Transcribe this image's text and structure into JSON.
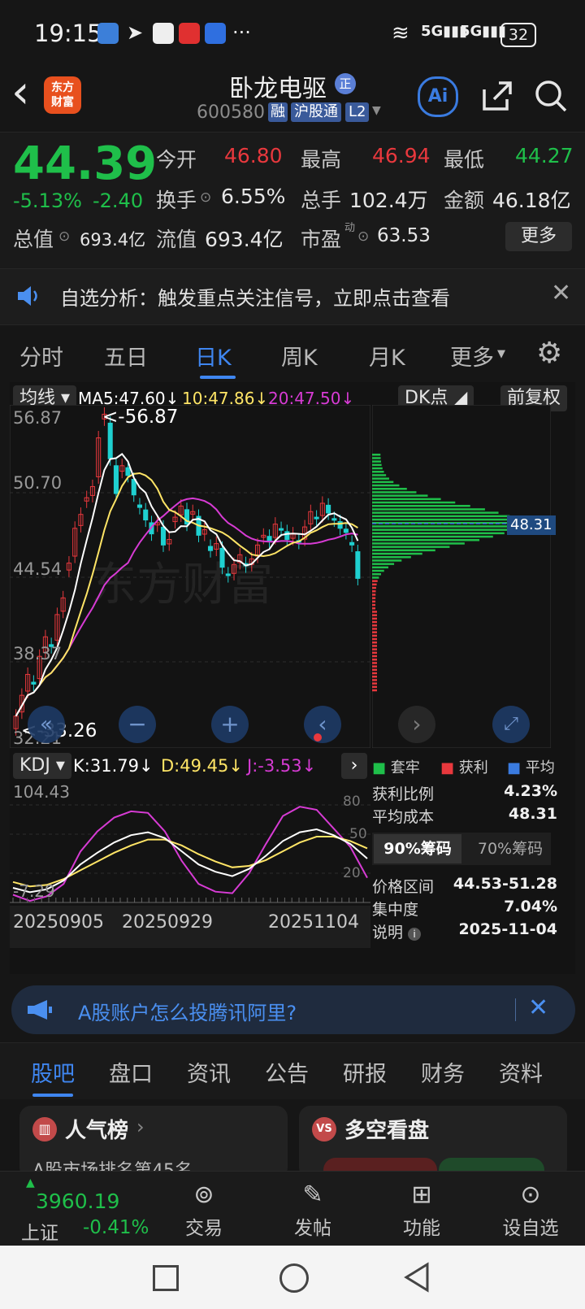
{
  "status_bar": {
    "time": "19:15",
    "battery": "32",
    "more": "···"
  },
  "header": {
    "back_glyph": "‹",
    "logo_line1": "东方",
    "logo_line2": "财富",
    "stock_name": "卧龙电驱",
    "stock_badge": "正",
    "code": "600580",
    "tag_rong": "融",
    "tag_hgt": "沪股通",
    "tag_l2": "L2",
    "ai_label": "Ai"
  },
  "quote": {
    "price": "44.39",
    "change_pct": "-5.13%",
    "change_amt": "-2.40",
    "open_label": "今开",
    "open": "46.80",
    "high_label": "最高",
    "high": "46.94",
    "low_label": "最低",
    "low": "44.27",
    "turnover_label": "换手",
    "turnover": "6.55%",
    "volume_label": "总手",
    "volume": "102.4万",
    "amount_label": "金额",
    "amount": "46.18亿",
    "mktcap_label": "总值",
    "mktcap": "693.4亿",
    "float_label": "流值",
    "float": "693.4亿",
    "pe_label": "市盈",
    "pe_sup": "动",
    "pe": "63.53",
    "more_label": "更多"
  },
  "banner": {
    "text": "自选分析：触发重点关注信号，立即点击查看"
  },
  "period_tabs": [
    "分时",
    "五日",
    "日K",
    "周K",
    "月K",
    "更多"
  ],
  "active_tab": 2,
  "chart": {
    "ma_selector": "均线",
    "ma5": "MA5:47.60↓",
    "ma10": "10:47.86↓",
    "ma20": "20:47.50↓",
    "dk_label": "DK点",
    "adjust_label": "前复权",
    "price_axis": [
      "56.87",
      "50.70",
      "44.54",
      "38.37",
      "32.21"
    ],
    "max_mark": "<-56.87",
    "min_mark": "<-33.26",
    "chip_avg": "48.31",
    "kdj_selector": "KDJ",
    "kdj_k": "K:31.79↓",
    "kdj_d": "D:49.45↓",
    "kdj_j": "J:-3.53↓",
    "kdj_axis": [
      "104.43",
      "-7.29"
    ],
    "kdj_right": [
      "80",
      "50",
      "20"
    ],
    "dates": [
      "20250905",
      "20250929",
      "20251104"
    ],
    "colors": {
      "up": "#e8383d",
      "down": "#1fd0d0",
      "ma5": "#ffffff",
      "ma10": "#ffe566",
      "ma20": "#d73bd4"
    }
  },
  "chips": {
    "legend_trapped": "套牢",
    "legend_profit": "获利",
    "legend_avg": "平均",
    "profit_ratio_label": "获利比例",
    "profit_ratio": "4.23%",
    "avg_cost_label": "平均成本",
    "avg_cost": "48.31",
    "tab90": "90%筹码",
    "tab70": "70%筹码",
    "range_label": "价格区间",
    "range": "44.53-51.28",
    "concentration_label": "集中度",
    "concentration": "7.04%",
    "note_label": "说明",
    "note": "2025-11-04"
  },
  "ad": {
    "text": "A股账户怎么投腾讯阿里?"
  },
  "bottom_tabs": [
    "股吧",
    "盘口",
    "资讯",
    "公告",
    "研报",
    "财务",
    "资料"
  ],
  "cards": {
    "popularity": "人气榜",
    "popularity_sub": "A股市场排名第45名",
    "bullbear": "多空看盘"
  },
  "bottom_nav": {
    "index_value": "3960.19",
    "index_name": "上证",
    "index_change": "-0.41%",
    "trade": "交易",
    "post": "发帖",
    "features": "功能",
    "watchlist": "设自选"
  }
}
